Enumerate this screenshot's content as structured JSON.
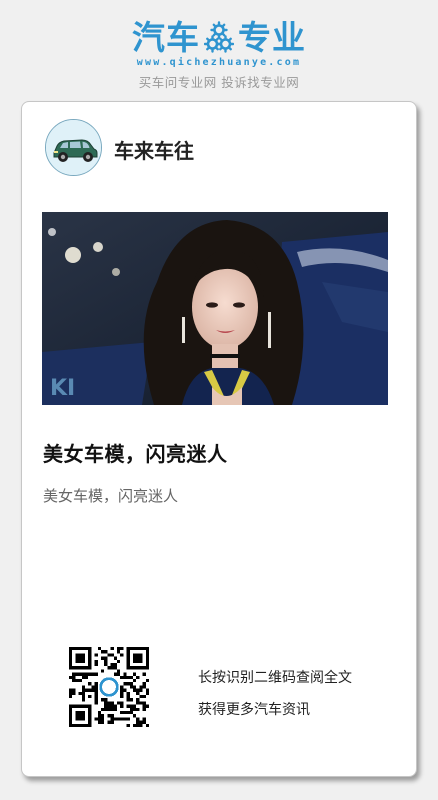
{
  "brand": {
    "name_left": "汽车",
    "name_right": "专业",
    "url": "www.qichezhuanye.com",
    "slogan": "买车问专业网 投诉找专业网",
    "color": "#2f94cf"
  },
  "account": {
    "name": "车来车往",
    "avatar_icon": "car-icon"
  },
  "article": {
    "image_desc_icon": "hero-photo",
    "title": "美女车模，闪亮迷人",
    "summary": "美女车模，闪亮迷人"
  },
  "qr": {
    "icon": "qr-code-icon",
    "line1": "长按识别二维码查阅全文",
    "line2": "获得更多汽车资讯"
  }
}
